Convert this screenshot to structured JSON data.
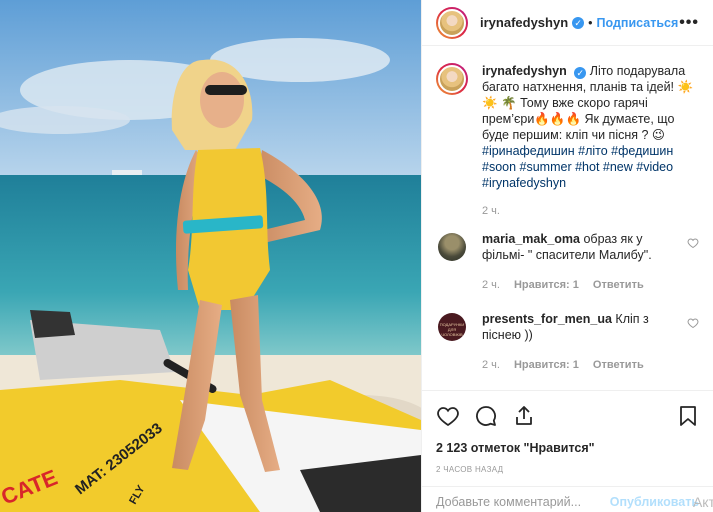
{
  "post": {
    "username": "irynafedyshyn",
    "follow_label": "Подписаться",
    "more_label": "•••",
    "caption_user": "irynafedyshyn",
    "caption_text": "Літо подарувала багато натхнення, планів та ідей! ☀️☀️ 🌴 Тому вже скоро гарячі прем’єри🔥🔥🔥 Як думаєте, що буде першим: кліп чи пісня ? 😉",
    "hashtags": "#ірина­федишин #літо #федишин #soon #summer #hot #new #video #irynafedyshyn",
    "caption_time": "2 ч."
  },
  "comments": [
    {
      "user": "maria_mak_oma",
      "text": "образ як у фільмі- \" спасители Малибу\".",
      "time": "2 ч.",
      "likes": "Нравится: 1",
      "reply": "Ответить"
    },
    {
      "user": "presents_for_men_ua",
      "text": "Кліп з піснею ))",
      "time": "2 ч.",
      "likes": "Нравится: 1",
      "reply": "Ответить",
      "avatar_text": "ПОДАРУНКИ ДЛЯ ЧОЛОВІКІВ"
    }
  ],
  "likes_text": "2 123 отметок \"Нравится\"",
  "posted_time": "2 ЧАСОВ НАЗАД",
  "comment_box": {
    "placeholder": "Добавьте комментарий...",
    "publish_label": "Опубликовать"
  },
  "watermark": "Акт",
  "photo": {
    "jetski_text_1": "MAT: 23052033",
    "jetski_text_2": "FLY",
    "jetski_text_3": "CATE"
  },
  "colors": {
    "link": "#3897f0",
    "hashtag": "#003569",
    "muted": "#999999",
    "sea": "#2e8fa3",
    "sky": "#7fb3dc",
    "swimsuit": "#f2c832"
  }
}
